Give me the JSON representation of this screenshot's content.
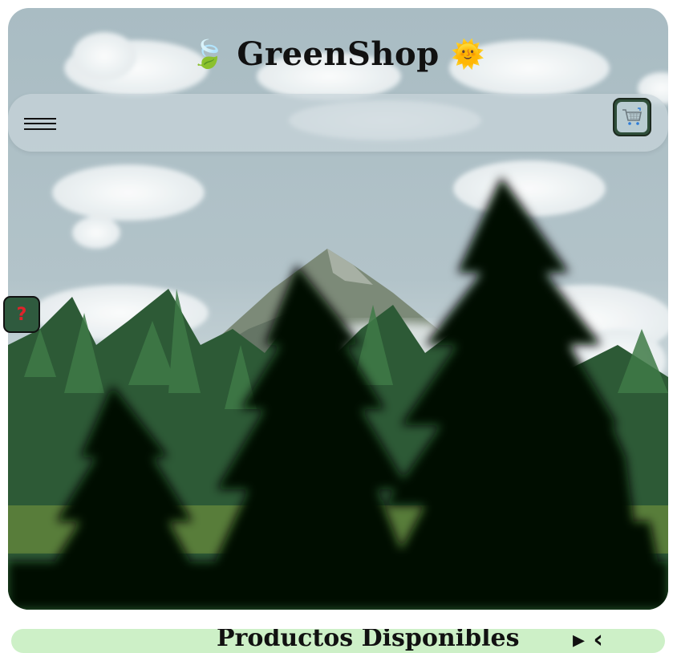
{
  "header": {
    "logo_icon": "leaf-emoji",
    "logo_glyph": "🍃",
    "title": "GreenShop",
    "mascot_icon": "smiling-sun-emoji",
    "mascot_glyph": "🌞"
  },
  "navbar": {
    "menu_icon": "hamburger-menu-icon",
    "cart_icon": "shopping-cart-icon"
  },
  "help_button": {
    "label": "?"
  },
  "section": {
    "title": "Productos Disponibles"
  },
  "colors": {
    "navbar_bg": "#c8d4da",
    "button_bg": "#2f4e3a",
    "help_mark": "#e0232b",
    "section_bar": "#cdf0c7"
  }
}
